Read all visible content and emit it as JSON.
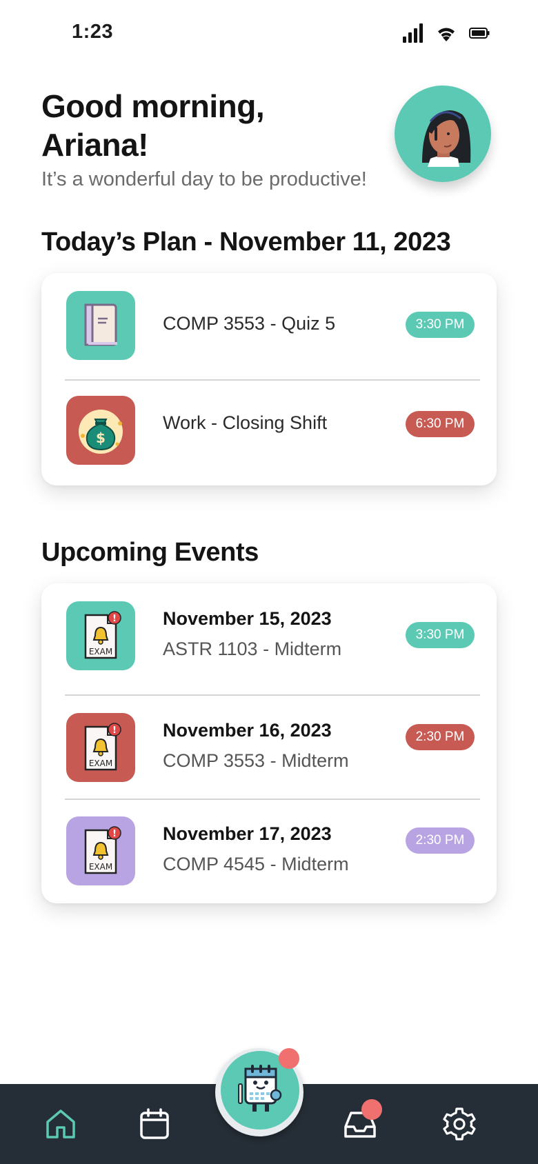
{
  "status_bar": {
    "time": "1:23"
  },
  "greeting": {
    "line1": "Good morning,",
    "line2": "Ariana!",
    "subtitle": "It’s a wonderful day to be productive!"
  },
  "todays_plan": {
    "title": "Today’s Plan - November 11, 2023",
    "items": [
      {
        "label": "COMP 3553 - Quiz 5",
        "time": "3:30 PM",
        "icon": "notebook-icon",
        "color": "#5bc9b4"
      },
      {
        "label": "Work - Closing Shift",
        "time": "6:30 PM",
        "icon": "money-bag-icon",
        "color": "#c75a52"
      }
    ]
  },
  "upcoming_events": {
    "title": "Upcoming Events",
    "items": [
      {
        "date": "November 15, 2023",
        "label": "ASTR 1103 - Midterm",
        "time": "3:30 PM",
        "icon": "exam-alert-icon",
        "icon_text": "EXAM",
        "color": "#5bc9b4"
      },
      {
        "date": "November 16, 2023",
        "label": "COMP 3553 - Midterm",
        "time": "2:30 PM",
        "icon": "exam-alert-icon",
        "icon_text": "EXAM",
        "color": "#c75a52"
      },
      {
        "date": "November 17, 2023",
        "label": "COMP 4545 - Midterm",
        "time": "2:30 PM",
        "icon": "exam-alert-icon",
        "icon_text": "EXAM",
        "color": "#b8a4e2"
      }
    ]
  },
  "nav": {
    "items": [
      "home-icon",
      "calendar-icon",
      "mascot-planner-icon",
      "inbox-icon",
      "settings-icon"
    ],
    "active": "home-icon",
    "accent": "#5bc9b4",
    "badge_color": "#f07070"
  }
}
